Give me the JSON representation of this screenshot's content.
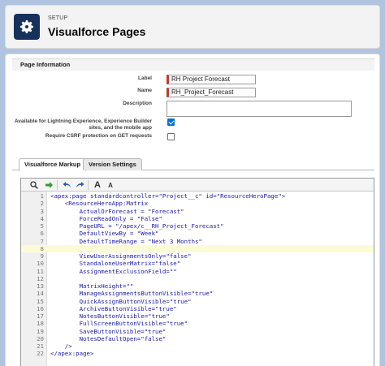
{
  "header": {
    "eyebrow": "SETUP",
    "title": "Visualforce Pages",
    "icon": "gear-icon"
  },
  "page_information": {
    "section_title": "Page Information",
    "label_label": "Label",
    "label_value": "RH Project Forecast",
    "name_label": "Name",
    "name_value": "RH_Project_Forecast",
    "description_label": "Description",
    "description_value": "",
    "lightning_label_line1": "Available for Lightning Experience, Experience Builder",
    "lightning_label_line2": "sites, and the mobile app",
    "lightning_checked": true,
    "csrf_label": "Require CSRF protection on GET requests",
    "csrf_checked": false
  },
  "tabs": [
    {
      "label": "Visualforce Markup",
      "active": true
    },
    {
      "label": "Version Settings",
      "active": false
    }
  ],
  "toolbar": {
    "search_icon": "search-icon",
    "goto_icon": "go-to-line-icon",
    "undo_icon": "undo-icon",
    "redo_icon": "redo-icon",
    "font_larger_label": "A",
    "font_smaller_label": "A"
  },
  "code": {
    "highlighted_line": 8,
    "lines": [
      "<apex:page standardcontroller=\"Project__c\" id=\"ResourceHeroPage\">",
      "    <ResourceHeroApp:Matrix",
      "        ActualOrForecast = \"Forecast\"",
      "        ForceReadOnly = \"False\"",
      "        PageURL = \"/apex/c__RH_Project_Forecast\"",
      "        DefaultViewBy = \"Week\"",
      "        DefaultTimeRange = \"Next 3 Months\"",
      "",
      "        ViewUserAssignmentsOnly=\"false\"",
      "        StandaloneUserMatrix=\"false\"",
      "        AssignmentExclusionField=\"\"",
      "",
      "        MatrixHeight=\"\"",
      "        ManageAssignmentsButtonVisible=\"true\"",
      "        QuickAssignButtonVisible=\"true\"",
      "        ArchiveButtonVisible=\"true\"",
      "        NotesButtonVisible=\"true\"",
      "        FullScreenButtonVisible=\"true\"",
      "        SaveButtonVisible=\"true\"",
      "        NotesDefaultOpen=\"false\"",
      "    />",
      "</apex:page>"
    ]
  },
  "colors": {
    "header_icon_bg": "#16325c",
    "code_text": "#1a1aa6",
    "required_bar": "#c23934",
    "checkbox_checked": "#0070d2",
    "highlight_line": "#fbfbd6"
  }
}
